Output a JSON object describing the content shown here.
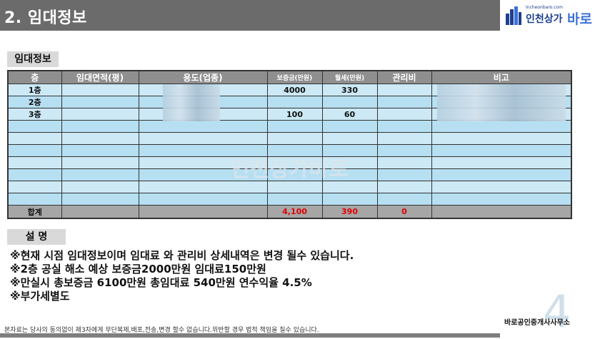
{
  "header": {
    "title": "2. 임대정보"
  },
  "logo": {
    "url_text": "Incheonbaro.com",
    "name_part1": "인천상가",
    "name_part2": "바로"
  },
  "table_section_label": "임대정보",
  "table": {
    "headers": [
      "층",
      "임대면적(평)",
      "용도(업종)",
      "보증금(만원)",
      "월세(만원)",
      "관리비",
      "비고"
    ],
    "rows": [
      [
        "1층",
        "",
        "",
        "4000",
        "330",
        "",
        ""
      ],
      [
        "2층",
        "",
        "",
        "",
        "",
        "",
        ""
      ],
      [
        "3층",
        "",
        "",
        "100",
        "60",
        "",
        ""
      ],
      [
        "",
        "",
        "",
        "",
        "",
        "",
        ""
      ],
      [
        "",
        "",
        "",
        "",
        "",
        "",
        ""
      ],
      [
        "",
        "",
        "",
        "",
        "",
        "",
        ""
      ],
      [
        "",
        "",
        "",
        "",
        "",
        "",
        ""
      ],
      [
        "",
        "",
        "",
        "",
        "",
        "",
        ""
      ],
      [
        "",
        "",
        "",
        "",
        "",
        "",
        ""
      ],
      [
        "",
        "",
        "",
        "",
        "",
        "",
        ""
      ]
    ],
    "total": {
      "label": "합계",
      "deposit": "4,100",
      "rent": "390",
      "fee": "0"
    },
    "total_color": "#e00000"
  },
  "notes_section_label": "설 명",
  "notes": [
    "※현재 시점 임대정보이며 임대료 와 관리비 상세내역은 변경 될수 있습니다.",
    "※2층 공실 해소 예상  보증금2000만원 임대료150만원",
    "※만실시 총보증금 6100만원 총임대료 540만원 연수익율 4.5%",
    "※부가세별도"
  ],
  "footer": {
    "disclaimer": "본자료는 당사의 동의없이 제3자에게 무단복제,배포,전송,변경 할수 없습니다.위반할 경우 법적 책임을 질수 있습니다.",
    "office": "바로공인중개사사무소",
    "page_number": "4"
  },
  "watermark": "인천상가바로"
}
